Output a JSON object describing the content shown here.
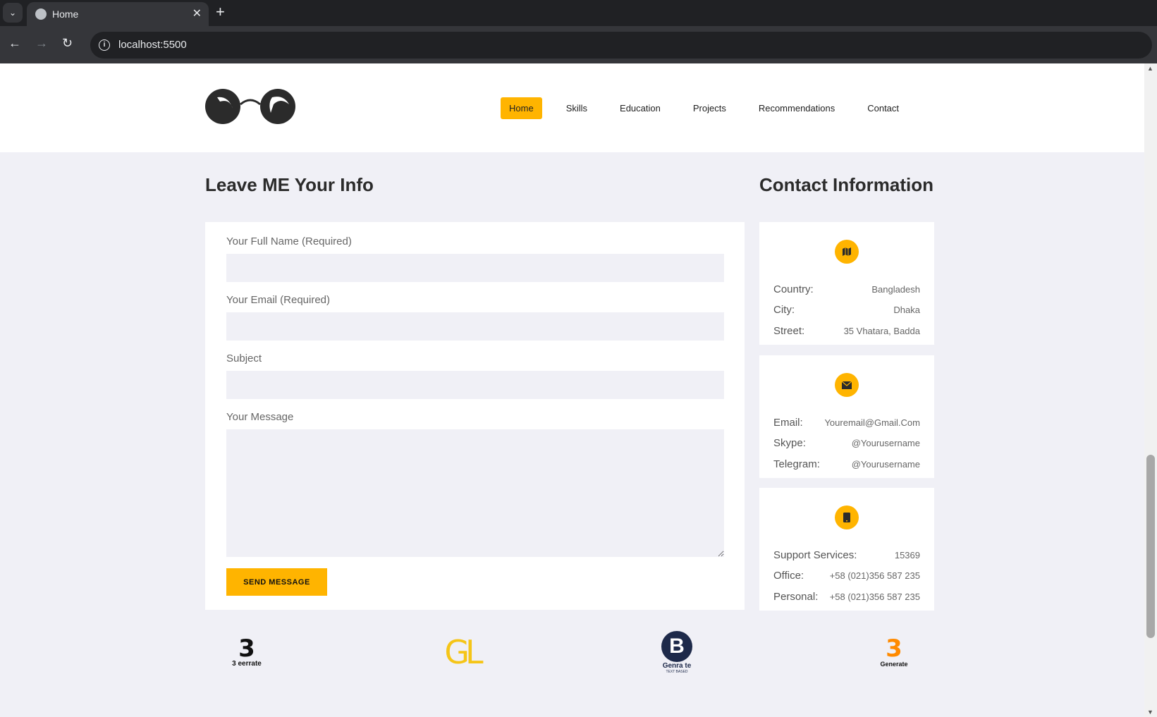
{
  "browser": {
    "tab_title": "Home",
    "url": "localhost:5500"
  },
  "nav": {
    "items": [
      {
        "label": "Home",
        "active": true
      },
      {
        "label": "Skills"
      },
      {
        "label": "Education"
      },
      {
        "label": "Projects"
      },
      {
        "label": "Recommendations"
      },
      {
        "label": "Contact"
      }
    ]
  },
  "form": {
    "heading": "Leave ME Your Info",
    "name_label": "Your Full Name (Required)",
    "email_label": "Your Email (Required)",
    "subject_label": "Subject",
    "message_label": "Your Message",
    "name_value": "",
    "email_value": "",
    "subject_value": "",
    "message_value": "",
    "submit_label": "SEND MESSAGE"
  },
  "contact": {
    "heading": "Contact Information",
    "cards": [
      {
        "icon": "map-icon",
        "rows": [
          {
            "key": "Country:",
            "value": "Bangladesh"
          },
          {
            "key": "City:",
            "value": "Dhaka"
          },
          {
            "key": "Street:",
            "value": "35 Vhatara, Badda"
          }
        ]
      },
      {
        "icon": "envelope-icon",
        "rows": [
          {
            "key": "Email:",
            "value": "Youremail@Gmail.Com"
          },
          {
            "key": "Skype:",
            "value": "@Yourusername"
          },
          {
            "key": "Telegram:",
            "value": "@Yourusername"
          }
        ]
      },
      {
        "icon": "phone-icon",
        "rows": [
          {
            "key": "Support Services:",
            "value": "15369"
          },
          {
            "key": "Office:",
            "value": "+58 (021)356 587 235"
          },
          {
            "key": "Personal:",
            "value": "+58 (021)356 587 235"
          }
        ]
      }
    ]
  },
  "brands": [
    {
      "name": "3 eerrate",
      "mark": "3"
    },
    {
      "name": "GL",
      "mark": "GL"
    },
    {
      "name": "Genra te",
      "mark": "B",
      "sub": "TEXT BASED"
    },
    {
      "name": "Generate",
      "mark": "3"
    }
  ],
  "colors": {
    "accent": "#ffb400",
    "page_bg": "#f0f0f6",
    "heading": "#2b2b2b"
  }
}
